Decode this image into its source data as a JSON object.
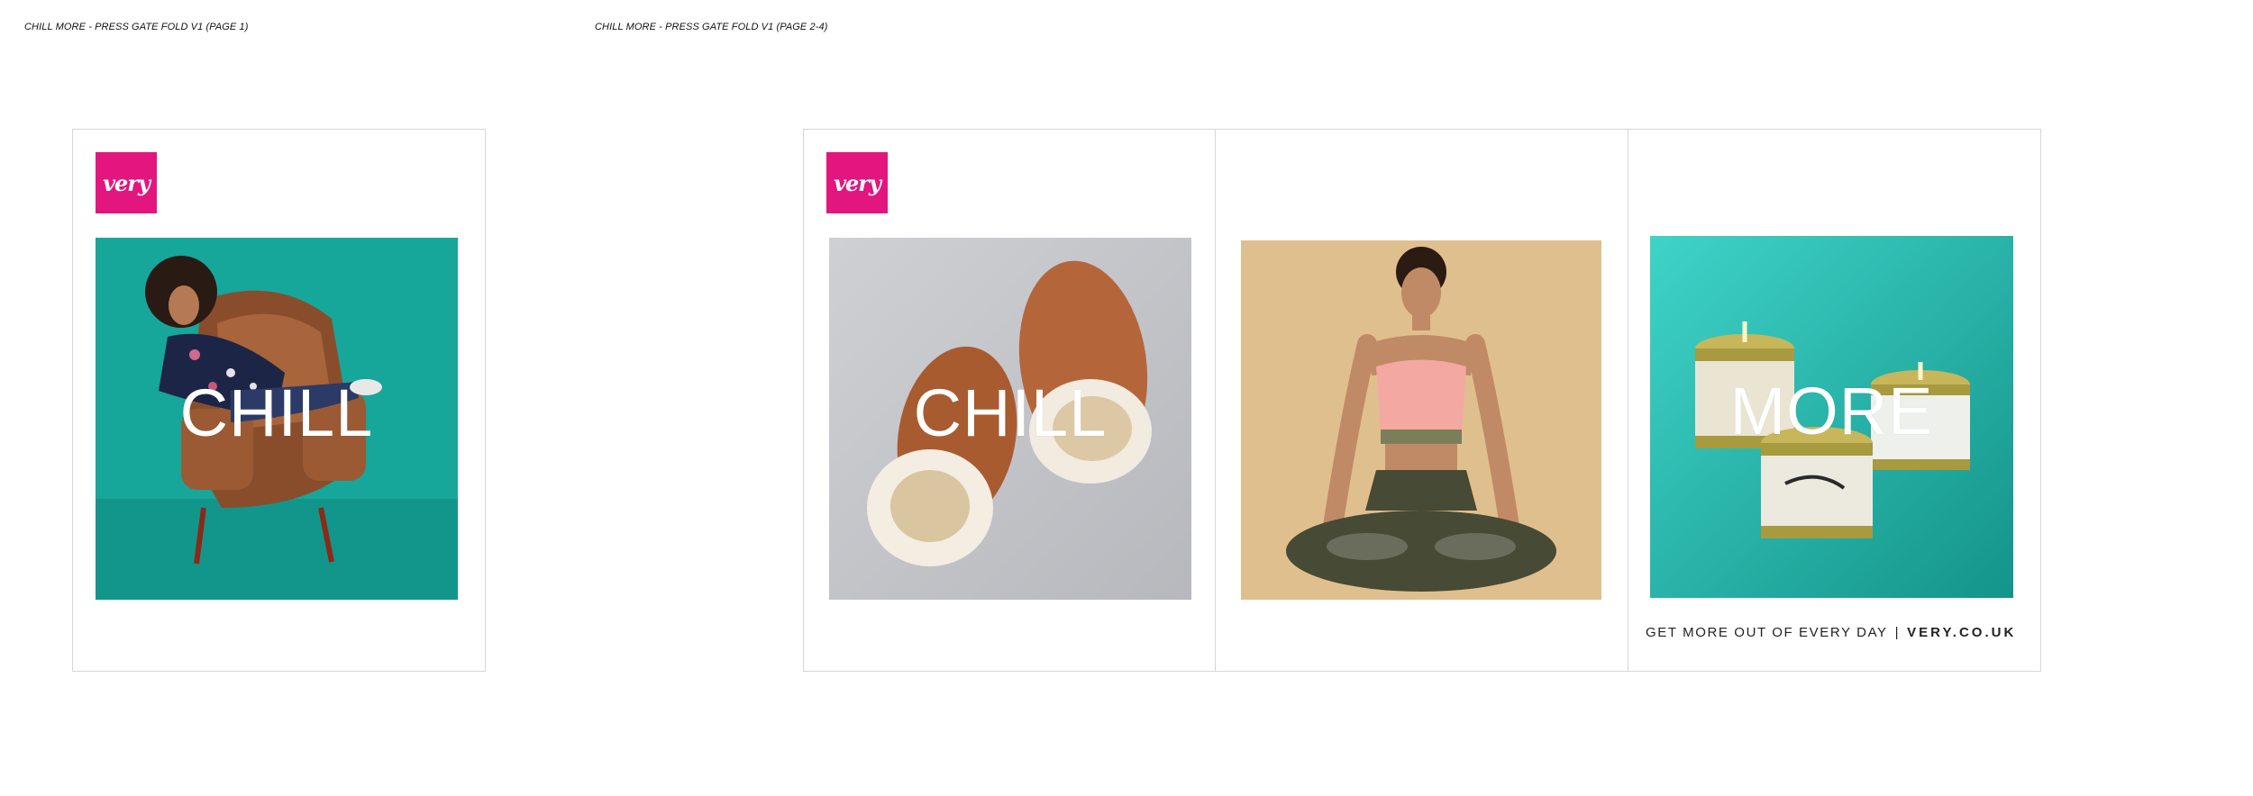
{
  "captions": {
    "page1": "CHILL MORE - PRESS GATE FOLD V1 (PAGE 1)",
    "page2_4": "CHILL MORE - PRESS GATE FOLD V1 (PAGE 2-4)"
  },
  "brand": {
    "logo_text": "very",
    "color": "#e2167e"
  },
  "panels": {
    "page1": {
      "overlay": "CHILL",
      "image_alt": "woman lounging in leather armchair on teal backdrop"
    },
    "page2": {
      "overlay": "CHILL",
      "image_alt": "sheepskin slippers on grey background"
    },
    "page3": {
      "image_alt": "woman meditating in lotus pose on tan background"
    },
    "page4": {
      "overlay": "MORE",
      "image_alt": "scented candle tins on teal background"
    }
  },
  "footer": {
    "tagline": "GET MORE OUT OF EVERY DAY",
    "separator": "|",
    "url": "VERY.CO.UK"
  }
}
